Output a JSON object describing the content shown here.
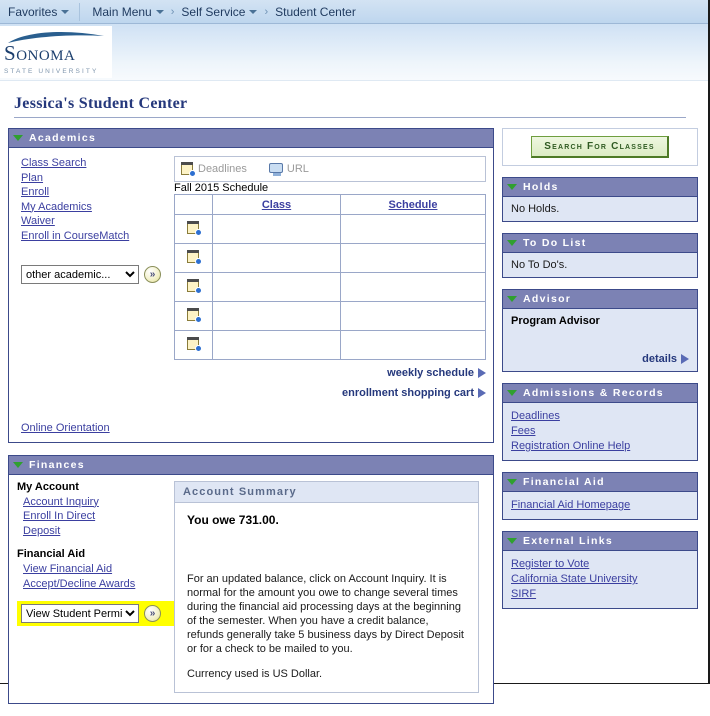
{
  "breadcrumb": {
    "favorites": "Favorites",
    "items": [
      "Main Menu",
      "Self Service",
      "Student Center"
    ],
    "separator": "›"
  },
  "logo": {
    "word_top": "S",
    "word": "ONOMA",
    "sub": "STATE UNIVERSITY"
  },
  "page_title": "Jessica's Student Center",
  "academics": {
    "header": "Academics",
    "links": [
      "Class Search",
      "Plan",
      "Enroll",
      "My Academics",
      "Waiver",
      "Enroll in CourseMatch"
    ],
    "select_value": "other academic...",
    "go_label": "»",
    "orientation_link": "Online Orientation",
    "deadlines_label": "Deadlines",
    "url_label": "URL",
    "schedule_title": "Fall 2015 Schedule",
    "col_class": "Class",
    "col_schedule": "Schedule",
    "rows": [
      {
        "class": "",
        "schedule": ""
      },
      {
        "class": "",
        "schedule": ""
      },
      {
        "class": "",
        "schedule": ""
      },
      {
        "class": "",
        "schedule": ""
      },
      {
        "class": "",
        "schedule": ""
      }
    ],
    "weekly_schedule": "weekly schedule",
    "shopping_cart": "enrollment shopping cart"
  },
  "finances": {
    "header": "Finances",
    "my_account_header": "My Account",
    "my_account_links": [
      "Account Inquiry",
      "Enroll In Direct",
      "Deposit"
    ],
    "financial_aid_header": "Financial Aid",
    "financial_aid_links": [
      "View Financial Aid",
      "Accept/Decline Awards"
    ],
    "select_value": "View Student Permiss",
    "go_label": "»",
    "summary_title": "Account Summary",
    "owe_text": "You owe 731.00.",
    "blurb": "For an updated balance, click on Account Inquiry.  It is normal for the amount you owe to change several times during the financial aid processing days at the beginning of the semester.  When you have a credit balance, refunds generally take 5 business days by Direct Deposit or for a check to be mailed to you.",
    "currency": "Currency used is US Dollar."
  },
  "sidebar": {
    "search_button": "Search For Classes",
    "holds": {
      "header": "Holds",
      "text": "No Holds."
    },
    "todo": {
      "header": "To Do List",
      "text": "No To Do's."
    },
    "advisor": {
      "header": "Advisor",
      "name": "Program Advisor",
      "details": "details"
    },
    "admissions": {
      "header": "Admissions & Records",
      "links": [
        "Deadlines",
        "Fees",
        "Registration Online Help"
      ]
    },
    "financial_aid": {
      "header": "Financial Aid",
      "links": [
        "Financial Aid Homepage"
      ]
    },
    "external": {
      "header": "External Links",
      "links": [
        "Register to Vote",
        "California State University",
        "SIRF"
      ]
    }
  },
  "colors": {
    "panel_header": "#7c82b4",
    "panel_body": "#dfe6f4",
    "link": "#3b3fa0",
    "title": "#25387c",
    "highlight": "#ffff00",
    "button_green": "#dcecc4"
  }
}
